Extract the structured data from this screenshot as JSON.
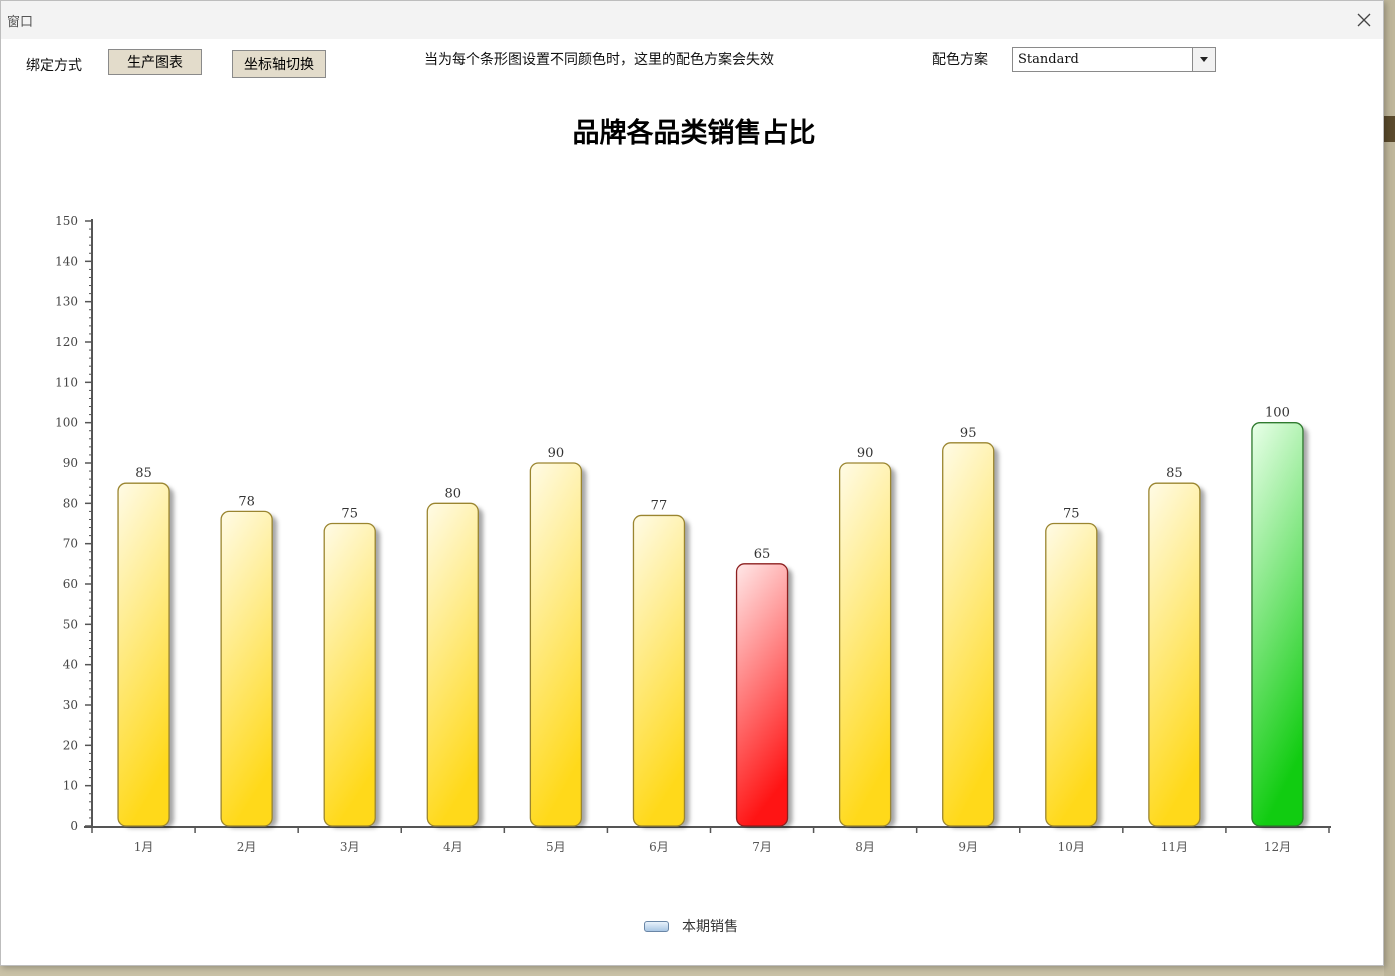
{
  "window": {
    "title": "窗口"
  },
  "toolbar": {
    "binding_label": "绑定方式",
    "generate_button": "生产图表",
    "axis_switch_button": "坐标轴切换",
    "notice": "当为每个条形图设置不同颜色时，这里的配色方案会失效",
    "scheme_label": "配色方案",
    "scheme_value": "Standard"
  },
  "legend": {
    "series_name": "本期销售"
  },
  "chart_data": {
    "type": "bar",
    "title": "品牌各品类销售占比",
    "xlabel": "",
    "ylabel": "",
    "categories": [
      "1月",
      "2月",
      "3月",
      "4月",
      "5月",
      "6月",
      "7月",
      "8月",
      "9月",
      "10月",
      "11月",
      "12月"
    ],
    "series": [
      {
        "name": "本期销售",
        "values": [
          85,
          78,
          75,
          80,
          90,
          77,
          65,
          90,
          95,
          75,
          85,
          100
        ]
      }
    ],
    "bar_colors": [
      "yellow",
      "yellow",
      "yellow",
      "yellow",
      "yellow",
      "yellow",
      "red",
      "yellow",
      "yellow",
      "yellow",
      "yellow",
      "green"
    ],
    "ylim": [
      0,
      150
    ],
    "yticks": [
      0,
      10,
      20,
      30,
      40,
      50,
      60,
      70,
      80,
      90,
      100,
      110,
      120,
      130,
      140,
      150
    ],
    "grid": false,
    "legend_position": "bottom",
    "data_labels": true,
    "colors": {
      "yellow_top": "#fffbe6",
      "yellow_bottom": "#ffd91a",
      "yellow_stroke": "#9a8530",
      "red_top": "#ffe8e8",
      "red_bottom": "#ff1414",
      "red_stroke": "#8c1f1f",
      "green_top": "#e9ffe9",
      "green_bottom": "#11cc11",
      "green_stroke": "#2f7a2f",
      "axis": "#555555"
    }
  }
}
